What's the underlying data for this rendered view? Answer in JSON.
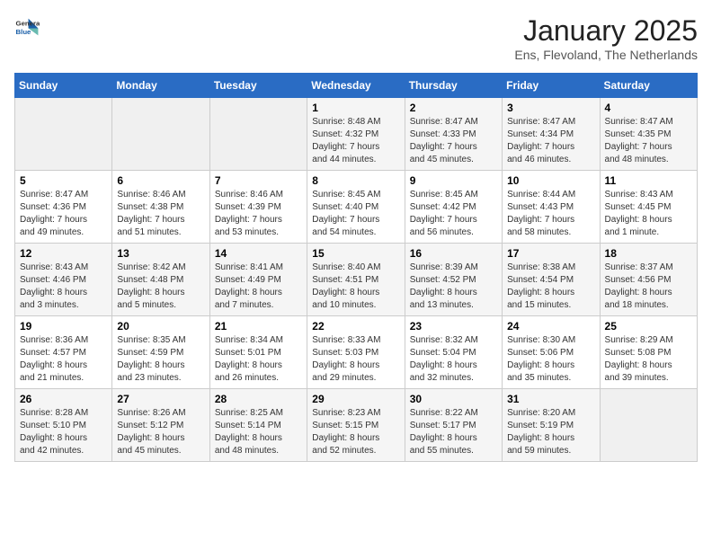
{
  "header": {
    "logo_line1": "General",
    "logo_line2": "Blue",
    "month": "January 2025",
    "location": "Ens, Flevoland, The Netherlands"
  },
  "days_of_week": [
    "Sunday",
    "Monday",
    "Tuesday",
    "Wednesday",
    "Thursday",
    "Friday",
    "Saturday"
  ],
  "weeks": [
    [
      {
        "day": "",
        "info": ""
      },
      {
        "day": "",
        "info": ""
      },
      {
        "day": "",
        "info": ""
      },
      {
        "day": "1",
        "info": "Sunrise: 8:48 AM\nSunset: 4:32 PM\nDaylight: 7 hours\nand 44 minutes."
      },
      {
        "day": "2",
        "info": "Sunrise: 8:47 AM\nSunset: 4:33 PM\nDaylight: 7 hours\nand 45 minutes."
      },
      {
        "day": "3",
        "info": "Sunrise: 8:47 AM\nSunset: 4:34 PM\nDaylight: 7 hours\nand 46 minutes."
      },
      {
        "day": "4",
        "info": "Sunrise: 8:47 AM\nSunset: 4:35 PM\nDaylight: 7 hours\nand 48 minutes."
      }
    ],
    [
      {
        "day": "5",
        "info": "Sunrise: 8:47 AM\nSunset: 4:36 PM\nDaylight: 7 hours\nand 49 minutes."
      },
      {
        "day": "6",
        "info": "Sunrise: 8:46 AM\nSunset: 4:38 PM\nDaylight: 7 hours\nand 51 minutes."
      },
      {
        "day": "7",
        "info": "Sunrise: 8:46 AM\nSunset: 4:39 PM\nDaylight: 7 hours\nand 53 minutes."
      },
      {
        "day": "8",
        "info": "Sunrise: 8:45 AM\nSunset: 4:40 PM\nDaylight: 7 hours\nand 54 minutes."
      },
      {
        "day": "9",
        "info": "Sunrise: 8:45 AM\nSunset: 4:42 PM\nDaylight: 7 hours\nand 56 minutes."
      },
      {
        "day": "10",
        "info": "Sunrise: 8:44 AM\nSunset: 4:43 PM\nDaylight: 7 hours\nand 58 minutes."
      },
      {
        "day": "11",
        "info": "Sunrise: 8:43 AM\nSunset: 4:45 PM\nDaylight: 8 hours\nand 1 minute."
      }
    ],
    [
      {
        "day": "12",
        "info": "Sunrise: 8:43 AM\nSunset: 4:46 PM\nDaylight: 8 hours\nand 3 minutes."
      },
      {
        "day": "13",
        "info": "Sunrise: 8:42 AM\nSunset: 4:48 PM\nDaylight: 8 hours\nand 5 minutes."
      },
      {
        "day": "14",
        "info": "Sunrise: 8:41 AM\nSunset: 4:49 PM\nDaylight: 8 hours\nand 7 minutes."
      },
      {
        "day": "15",
        "info": "Sunrise: 8:40 AM\nSunset: 4:51 PM\nDaylight: 8 hours\nand 10 minutes."
      },
      {
        "day": "16",
        "info": "Sunrise: 8:39 AM\nSunset: 4:52 PM\nDaylight: 8 hours\nand 13 minutes."
      },
      {
        "day": "17",
        "info": "Sunrise: 8:38 AM\nSunset: 4:54 PM\nDaylight: 8 hours\nand 15 minutes."
      },
      {
        "day": "18",
        "info": "Sunrise: 8:37 AM\nSunset: 4:56 PM\nDaylight: 8 hours\nand 18 minutes."
      }
    ],
    [
      {
        "day": "19",
        "info": "Sunrise: 8:36 AM\nSunset: 4:57 PM\nDaylight: 8 hours\nand 21 minutes."
      },
      {
        "day": "20",
        "info": "Sunrise: 8:35 AM\nSunset: 4:59 PM\nDaylight: 8 hours\nand 23 minutes."
      },
      {
        "day": "21",
        "info": "Sunrise: 8:34 AM\nSunset: 5:01 PM\nDaylight: 8 hours\nand 26 minutes."
      },
      {
        "day": "22",
        "info": "Sunrise: 8:33 AM\nSunset: 5:03 PM\nDaylight: 8 hours\nand 29 minutes."
      },
      {
        "day": "23",
        "info": "Sunrise: 8:32 AM\nSunset: 5:04 PM\nDaylight: 8 hours\nand 32 minutes."
      },
      {
        "day": "24",
        "info": "Sunrise: 8:30 AM\nSunset: 5:06 PM\nDaylight: 8 hours\nand 35 minutes."
      },
      {
        "day": "25",
        "info": "Sunrise: 8:29 AM\nSunset: 5:08 PM\nDaylight: 8 hours\nand 39 minutes."
      }
    ],
    [
      {
        "day": "26",
        "info": "Sunrise: 8:28 AM\nSunset: 5:10 PM\nDaylight: 8 hours\nand 42 minutes."
      },
      {
        "day": "27",
        "info": "Sunrise: 8:26 AM\nSunset: 5:12 PM\nDaylight: 8 hours\nand 45 minutes."
      },
      {
        "day": "28",
        "info": "Sunrise: 8:25 AM\nSunset: 5:14 PM\nDaylight: 8 hours\nand 48 minutes."
      },
      {
        "day": "29",
        "info": "Sunrise: 8:23 AM\nSunset: 5:15 PM\nDaylight: 8 hours\nand 52 minutes."
      },
      {
        "day": "30",
        "info": "Sunrise: 8:22 AM\nSunset: 5:17 PM\nDaylight: 8 hours\nand 55 minutes."
      },
      {
        "day": "31",
        "info": "Sunrise: 8:20 AM\nSunset: 5:19 PM\nDaylight: 8 hours\nand 59 minutes."
      },
      {
        "day": "",
        "info": ""
      }
    ]
  ]
}
